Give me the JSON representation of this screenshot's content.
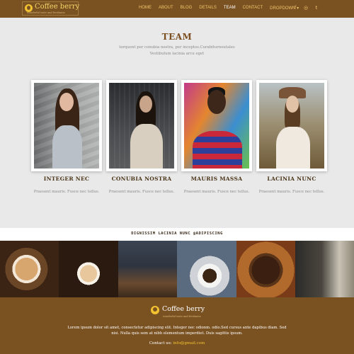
{
  "header": {
    "logo_name": "Coffee berry",
    "logo_tagline": "wonderful taste and freshness",
    "nav": [
      "HOME",
      "ABOUT",
      "BLOG",
      "DETAILS",
      "TEAM",
      "CONTACT",
      "DROPDOWN"
    ],
    "nav_active": "TEAM",
    "dropdown_caret": "▾",
    "social": [
      "f",
      "◎",
      "t"
    ]
  },
  "team": {
    "title": "TEAM",
    "subtitle": "torquent per conubia nostra, per inceptos.Curabiturnoutales Vestibulum lacinia arcu eget",
    "members": [
      {
        "name": "INTEGER NEC",
        "desc": "Praesent mauris. Fusce nec tellus."
      },
      {
        "name": "CONUBIA NOSTRA",
        "desc": "Praesent mauris. Fusce nec tellus."
      },
      {
        "name": "MAURIS MASSA",
        "desc": "Praesent mauris. Fusce nec tellus."
      },
      {
        "name": "LACINIA NUNC",
        "desc": "Praesent mauris. Fusce nec tellus."
      }
    ]
  },
  "banner": {
    "text": "DIGNISSIM LACINIA NUNC @ADIPISCING"
  },
  "gallery": [
    "latte-art-cups",
    "pouring-latte",
    "coffee-still-life",
    "cup-and-kettle",
    "coffee-beans-bowl",
    "cup-by-window"
  ],
  "footer": {
    "logo_name": "Coffee berry",
    "tagline": "wonderful taste and freshness",
    "text": "Lorem ipsum dolor sit amet, consectetur adipiscing elit. Integer nec odionm. odio.Sed cursus ante dapibus diam. Sed nisi. Nulla quis sem at nibh elementum imperdiet. Duis sagittis ipsum.",
    "contact_label": "Contact us:",
    "contact_email": "info@gmail.com"
  },
  "colors": {
    "brand_brown": "#7a5222",
    "accent_gold": "#f2c230",
    "page_bg": "#e9e9e9"
  }
}
